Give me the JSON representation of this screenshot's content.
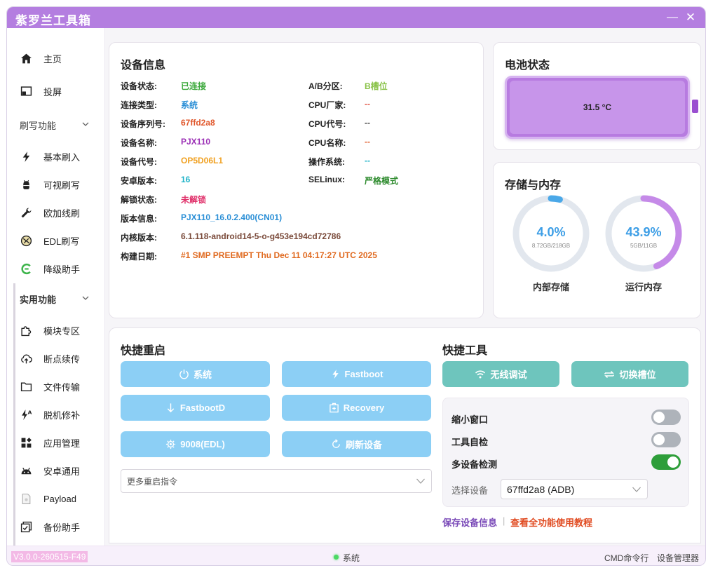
{
  "app": {
    "title": "紫罗兰工具箱",
    "minimize_glyph": "—",
    "close_glyph": "✕"
  },
  "sidebar": {
    "items_top": [
      {
        "label": "主页",
        "icon": "home-icon"
      },
      {
        "label": "投屏",
        "icon": "screen-cast-icon"
      }
    ],
    "group_flash": {
      "label": "刷写功能"
    },
    "flash_items": [
      {
        "label": "基本刷入",
        "icon": "lightning-icon"
      },
      {
        "label": "可视刷写",
        "icon": "android-icon"
      },
      {
        "label": "欧加线刷",
        "icon": "wrench-icon"
      },
      {
        "label": "EDL刷写",
        "icon": "edl-icon"
      },
      {
        "label": "降级助手",
        "icon": "downgrade-icon"
      }
    ],
    "group_util": {
      "label": "实用功能"
    },
    "util_items": [
      {
        "label": "模块专区",
        "icon": "puzzle-icon"
      },
      {
        "label": "断点续传",
        "icon": "cloud-upload-icon"
      },
      {
        "label": "文件传输",
        "icon": "folder-icon"
      },
      {
        "label": "脱机修补",
        "icon": "patch-icon"
      },
      {
        "label": "应用管理",
        "icon": "apps-icon"
      },
      {
        "label": "安卓通用",
        "icon": "android-head-icon"
      },
      {
        "label": "Payload",
        "icon": "file-icon"
      },
      {
        "label": "备份助手",
        "icon": "backup-icon"
      }
    ]
  },
  "device_info": {
    "title": "设备信息",
    "left": [
      {
        "label": "设备状态:",
        "value": "已连接",
        "color": "#3aa83a"
      },
      {
        "label": "连接类型:",
        "value": "系统",
        "color": "#2b8fd6"
      },
      {
        "label": "设备序列号:",
        "value": "67ffd2a8",
        "color": "#e0562a"
      },
      {
        "label": "设备名称:",
        "value": "PJX110",
        "color": "#9b2fb5"
      },
      {
        "label": "设备代号:",
        "value": "OP5D06L1",
        "color": "#f0a020"
      },
      {
        "label": "安卓版本:",
        "value": "16",
        "color": "#1fb3c8"
      },
      {
        "label": "解锁状态:",
        "value": "未解锁",
        "color": "#e0306a"
      },
      {
        "label": "版本信息:",
        "value": "PJX110_16.0.2.400(CN01)",
        "color": "#2b8fd6"
      },
      {
        "label": "内核版本:",
        "value": "6.1.118-android14-5-o-g453e194cd72786",
        "color": "#7a4a3a"
      },
      {
        "label": "构建日期:",
        "value": "#1 SMP PREEMPT Thu Dec 11 04:17:27 UTC 2025",
        "color": "#e06a20"
      }
    ],
    "right": [
      {
        "label": "A/B分区:",
        "value": "B槽位",
        "color": "#8bc34a"
      },
      {
        "label": "CPU厂家:",
        "value": "--",
        "color": "#e05040"
      },
      {
        "label": "CPU代号:",
        "value": "--",
        "color": "#444444"
      },
      {
        "label": "CPU名称:",
        "value": "--",
        "color": "#e06030"
      },
      {
        "label": "操作系统:",
        "value": "--",
        "color": "#1fb3c8"
      },
      {
        "label": "SELinux:",
        "value": "严格模式",
        "color": "#2e8b2e"
      }
    ]
  },
  "battery": {
    "title": "电池状态",
    "temperature": "31.5 °C",
    "color": "#b77be0"
  },
  "storage": {
    "title": "存储与内存",
    "internal": {
      "percent_text": "4.0%",
      "fraction": 0.04,
      "detail": "8.72GB/218GB",
      "name": "内部存储",
      "color": "#4aa8e8"
    },
    "ram": {
      "percent_text": "43.9%",
      "fraction": 0.439,
      "detail": "5GB/11GB",
      "name": "运行内存",
      "color": "#c58ae8"
    }
  },
  "quick_reboot": {
    "title": "快捷重启",
    "buttons": [
      {
        "label": "系统",
        "icon": "power-icon"
      },
      {
        "label": "Fastboot",
        "icon": "lightning-icon"
      },
      {
        "label": "FastbootD",
        "icon": "arrow-down-icon"
      },
      {
        "label": "Recovery",
        "icon": "recovery-icon"
      },
      {
        "label": "9008(EDL)",
        "icon": "chip-icon"
      },
      {
        "label": "刷新设备",
        "icon": "refresh-icon"
      }
    ],
    "more_placeholder": "更多重启指令"
  },
  "quick_tools": {
    "title": "快捷工具",
    "buttons": [
      {
        "label": "无线调试",
        "icon": "wifi-icon"
      },
      {
        "label": "切换槽位",
        "icon": "swap-icon"
      }
    ],
    "settings": [
      {
        "label": "缩小窗口",
        "on": false
      },
      {
        "label": "工具自检",
        "on": false
      },
      {
        "label": "多设备检测",
        "on": true
      }
    ],
    "device_select_label": "选择设备",
    "device_select_value": "67ffd2a8 (ADB)",
    "link_save": "保存设备信息",
    "link_separator": "|",
    "link_tutorial": "查看全功能使用教程"
  },
  "statusbar": {
    "version": "V3.0.0-260515-F49",
    "status": "系统",
    "cmd": "CMD命令行",
    "device_manager": "设备管理器"
  }
}
